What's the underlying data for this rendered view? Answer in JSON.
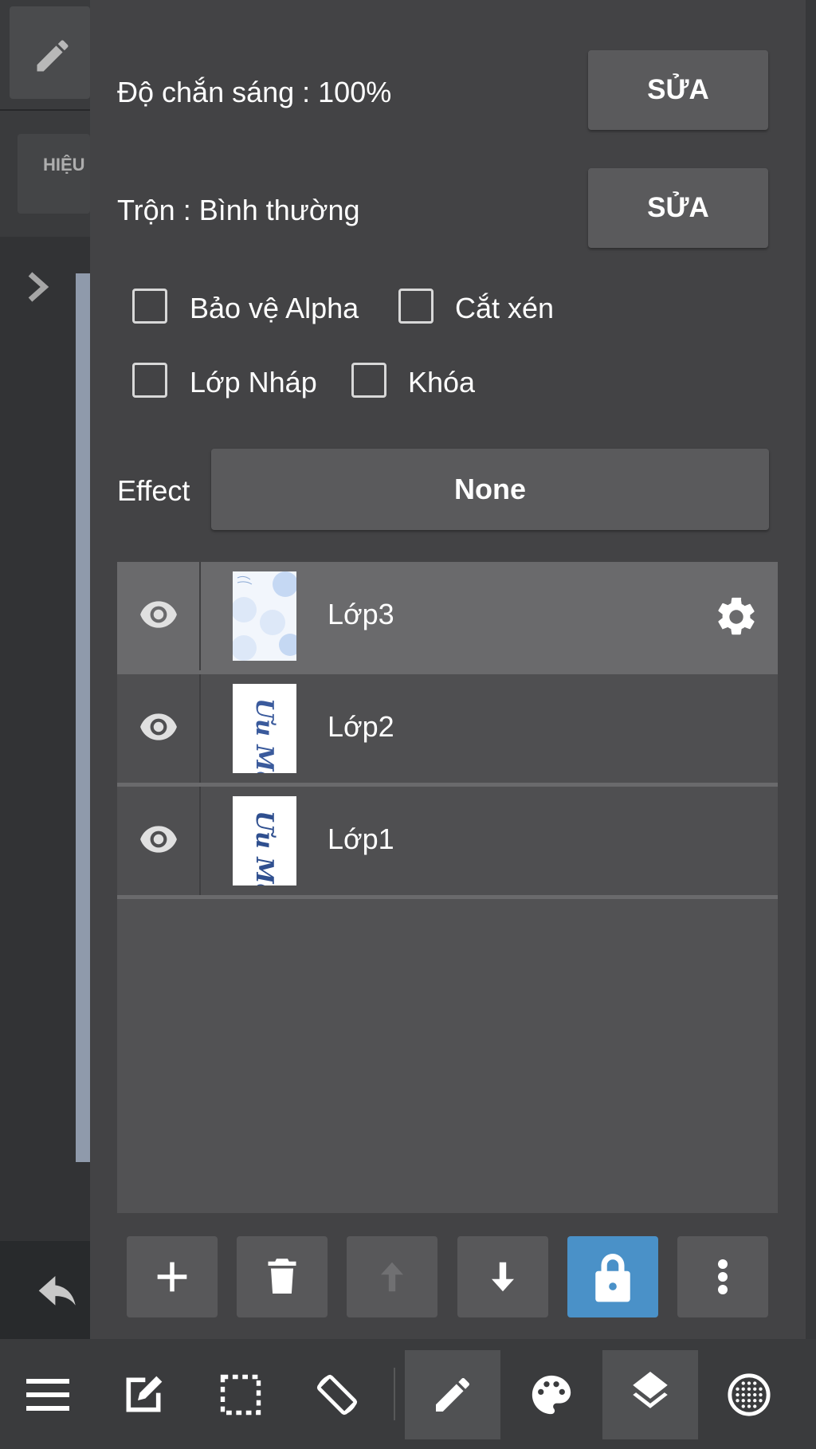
{
  "left_panel": {
    "effect_tab_label": "HIỆU"
  },
  "properties": {
    "opacity_label": "Độ chắn sáng : 100%",
    "opacity_edit": "SỬA",
    "blend_label": "Trộn : Bình thường",
    "blend_edit": "SỬA",
    "checkboxes": [
      {
        "label": "Bảo vệ Alpha",
        "checked": false
      },
      {
        "label": "Cắt xén",
        "checked": false
      },
      {
        "label": "Lớp Nháp",
        "checked": false
      },
      {
        "label": "Khóa",
        "checked": false
      }
    ],
    "effect_label": "Effect",
    "effect_value": "None"
  },
  "layers": [
    {
      "name": "Lớp3",
      "visible": true,
      "selected": true,
      "thumb": "blue-dots"
    },
    {
      "name": "Lớp2",
      "visible": true,
      "selected": false,
      "thumb": "calligraphy"
    },
    {
      "name": "Lớp1",
      "visible": true,
      "selected": false,
      "thumb": "calligraphy"
    }
  ],
  "thumbnail_text": "Ưu Mẫu",
  "layer_actions": [
    "plus-icon",
    "trash-icon",
    "arrow-up-icon",
    "arrow-down-icon",
    "lock-icon",
    "more-vertical-icon"
  ],
  "bottom_toolbar": [
    "menu-icon",
    "edit-square-icon",
    "selection-icon",
    "rotate-icon",
    "pen-icon",
    "palette-icon",
    "layers-icon",
    "grid-globe-icon"
  ],
  "colors": {
    "panel": "#434345",
    "button": "#5a5a5c",
    "accent": "#4a91c8",
    "layer_active": "#6a6a6c"
  }
}
